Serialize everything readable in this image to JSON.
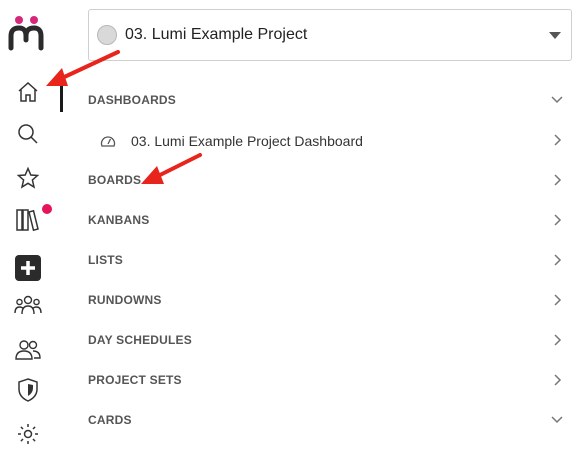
{
  "project": {
    "name": "03. Lumi Example Project",
    "icon": "project-avatar-icon"
  },
  "sidebar": {
    "icons": [
      "logo",
      "home-icon",
      "search-icon",
      "star-icon",
      "library-icon",
      "add-square-icon",
      "team-icon",
      "users-icon",
      "shield-icon",
      "gear-icon"
    ],
    "notification_color": "#e6135a"
  },
  "sections": [
    {
      "label": "DASHBOARDS",
      "state": "expanded"
    },
    {
      "label": "BOARDS",
      "state": "collapsed"
    },
    {
      "label": "KANBANS",
      "state": "collapsed"
    },
    {
      "label": "LISTS",
      "state": "collapsed"
    },
    {
      "label": "RUNDOWNS",
      "state": "collapsed"
    },
    {
      "label": "DAY SCHEDULES",
      "state": "collapsed"
    },
    {
      "label": "PROJECT SETS",
      "state": "collapsed"
    },
    {
      "label": "CARDS",
      "state": "expanded"
    }
  ],
  "dashboard_items": [
    {
      "label": "03. Lumi Example Project Dashboard",
      "icon": "dashboard-gauge-icon"
    }
  ],
  "colors": {
    "annotation_arrow": "#e8251c",
    "logo_pink": "#d6287a",
    "logo_dark": "#2b2b2b"
  }
}
